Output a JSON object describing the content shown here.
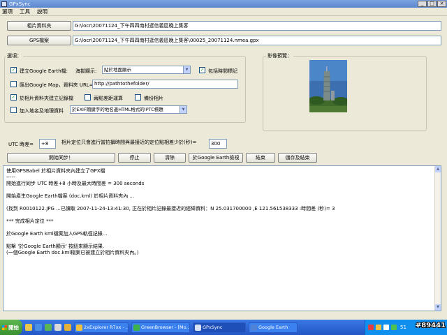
{
  "window": {
    "title": "GPxSync"
  },
  "menu": [
    "選項",
    "工具",
    "說明"
  ],
  "photo_folder": {
    "button": "相片資料夾",
    "value": "G:\\locr\\20071124_下午四四南村逛信義區晚上集客"
  },
  "gps_file": {
    "button": "GPS檔案",
    "value": "G:\\locr\\20071124_下午四四南村逛信義區晚上集客\\00025_20071124.nmea.gpx"
  },
  "options": {
    "label": "選項：",
    "create_ge": {
      "label": "建立Google Earth檔:",
      "checked": true
    },
    "marker_label": "海拔顯示:",
    "marker_value": "貼於地面顯示",
    "include_time": {
      "label": "包括時間標記",
      "checked": true
    },
    "export_gmap": {
      "label": "匯出Google Map，資料夾 URL=",
      "checked": false
    },
    "url_value": "http://pathtothefolder/",
    "write_record": {
      "label": "於相片資料夾建立記錄檔",
      "checked": true
    },
    "two_point": {
      "label": "兩點差距運算",
      "checked": false
    },
    "backup": {
      "label": "備份相片",
      "checked": false
    },
    "add_location": {
      "label": "加入地名及地理資料",
      "checked": false
    },
    "location_value": "於EXIF關鍵字的地名邊HTML格式的IPTC標題"
  },
  "preview": {
    "label": "影像預覽："
  },
  "utc": {
    "label": "UTC 時差=",
    "value": "+8",
    "desc": "相片定位只會進行當拍攝時間與最接近的定位點相差少於(秒)=",
    "seconds": "300"
  },
  "actions": {
    "sync": "開始同步！",
    "stop": "停止",
    "clear": "清除",
    "view_ge": "於Google Earth檢視",
    "finish": "結束",
    "save_finish": "儲存及結束"
  },
  "log": [
    "使用GPSBabel 於相片資料夾內建立了GPX檔",
    "-----",
    "開始進行同步 UTC 時差+8 小時及最大時間差 = 300 seconds",
    "",
    "開始產生Google Earth檔案 (doc.kml) 於相片資料夾內 ...",
    "",
    "(找到 R0010122.JPG ...已讀取 2007-11-24-13:41:30, 正在於相片記錄最接近的經緯資料：N 25.031700000 ,E 121.561538333 :時間差 (秒)= 3",
    "",
    "*** 完成相片定位 ***",
    "",
    "於Google Earth kml檔案加入GPS軌徑記錄...",
    "",
    "點擊 '於Google Earth顯示' 按鈕來顯示結果.",
    "(一個Google Earth doc.kml檔案已被建立於相片資料夾內。)"
  ],
  "taskbar": {
    "start": "開始",
    "tasks": [
      "2xExplorer R7xx - ...",
      "GreenBrowser - [Mo...",
      "GPxSync",
      "Google Earth"
    ],
    "tray_num": "51"
  },
  "watermark": "#89441",
  "colors": {
    "title_bar": "#5b85cf",
    "taskbar": "#2456c6",
    "tray": "#0f8fee",
    "start": "#3a8f2f"
  }
}
